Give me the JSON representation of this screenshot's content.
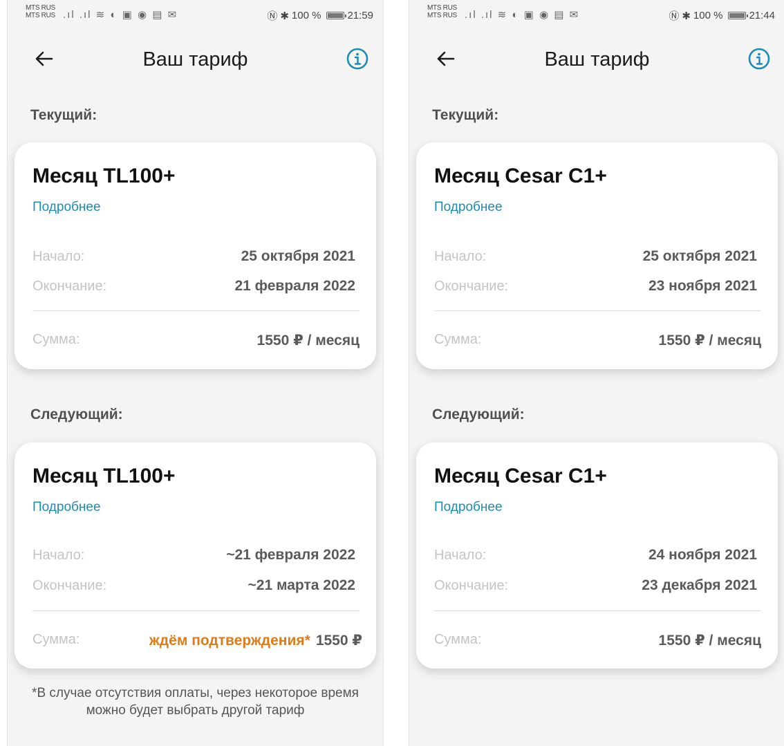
{
  "screens": [
    {
      "status": {
        "carrier1": "MTS RUS",
        "carrier2": "MTS RUS",
        "battery": "100 %",
        "time": "21:59"
      },
      "header": {
        "title": "Ваш тариф"
      },
      "current": {
        "section_label": "Текущий:",
        "plan": "Месяц TL100+",
        "details_link": "Подробнее",
        "start_label": "Начало:",
        "start_value": "25 октября 2021",
        "end_label": "Окончание:",
        "end_value": "21 февраля 2022",
        "sum_label": "Сумма:",
        "sum_value": "1550 ₽ / месяц"
      },
      "next": {
        "section_label": "Следующий:",
        "plan": "Месяц TL100+",
        "details_link": "Подробнее",
        "start_label": "Начало:",
        "start_value": "~21 февраля 2022",
        "end_label": "Окончание:",
        "end_value": "~21 марта 2022",
        "sum_label": "Сумма:",
        "sum_pending": "ждём подтверждения*",
        "sum_value": "1550 ₽"
      },
      "footnote": "*В случае отсутствия оплаты, через некоторое время можно будет выбрать другой тариф"
    },
    {
      "status": {
        "carrier1": "MTS RUS",
        "carrier2": "MTS RUS",
        "battery": "100 %",
        "time": "21:44"
      },
      "header": {
        "title": "Ваш тариф"
      },
      "current": {
        "section_label": "Текущий:",
        "plan": "Месяц Cesar C1+",
        "details_link": "Подробнее",
        "start_label": "Начало:",
        "start_value": "25 октября 2021",
        "end_label": "Окончание:",
        "end_value": "23 ноября 2021",
        "sum_label": "Сумма:",
        "sum_value": "1550 ₽ / месяц"
      },
      "next": {
        "section_label": "Следующий:",
        "plan": "Месяц Cesar C1+",
        "details_link": "Подробнее",
        "start_label": "Начало:",
        "start_value": "24 ноября 2021",
        "end_label": "Окончание:",
        "end_value": "23 декабря 2021",
        "sum_label": "Сумма:",
        "sum_value": "1550 ₽ / месяц"
      }
    }
  ],
  "colors": {
    "accent_link": "#1a8db5",
    "info_icon": "#1a8db5",
    "pending": "#e07b1a",
    "background": "#f4f4f4"
  },
  "icons": {
    "back": "arrow-left-icon",
    "info": "info-circle-icon",
    "status": [
      "signal-icon",
      "wifi-icon",
      "nfc-icon",
      "bluetooth-icon",
      "battery-icon"
    ]
  }
}
